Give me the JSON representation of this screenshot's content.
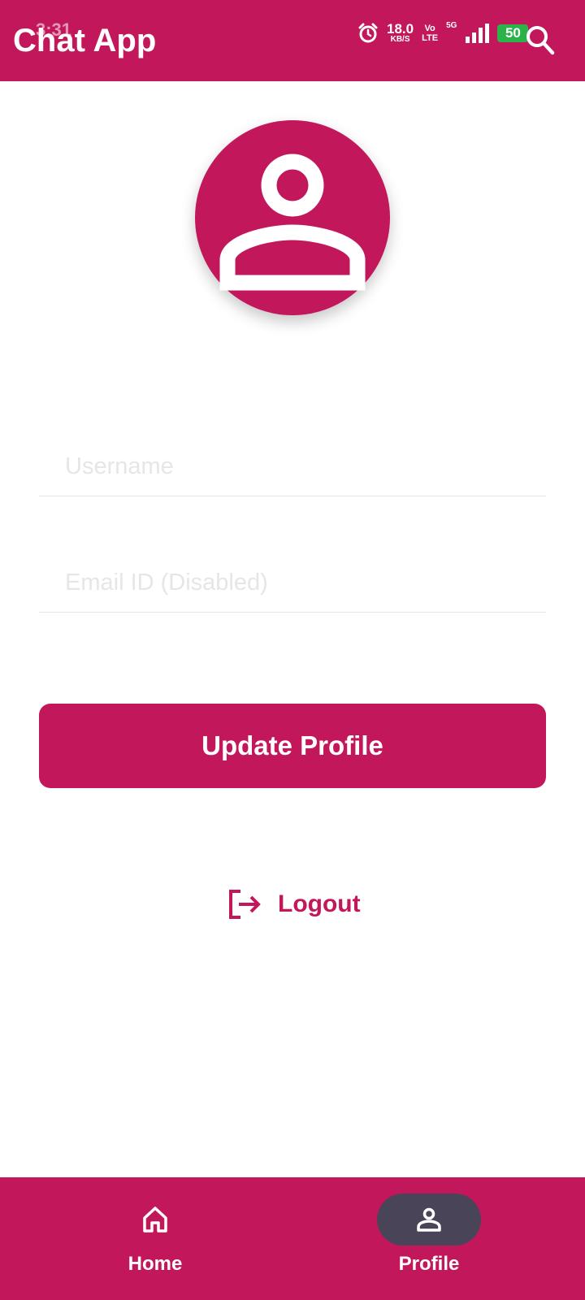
{
  "status_bar": {
    "time": "3:31",
    "net_speed_value": "18.0",
    "net_speed_unit": "KB/S",
    "volte_top": "Vo",
    "volte_bottom": "LTE",
    "network_type": "5G",
    "battery_level": "50"
  },
  "app_bar": {
    "title": "Chat App",
    "action_icon": "search-icon"
  },
  "profile": {
    "avatar_icon": "person-icon",
    "username": {
      "value": "",
      "placeholder": "Username"
    },
    "email": {
      "value": "",
      "placeholder": "Email ID (Disabled)"
    },
    "update_button_label": "Update Profile",
    "logout_label": "Logout",
    "logout_icon": "logout-icon"
  },
  "bottom_nav": {
    "items": [
      {
        "label": "Home",
        "icon": "home-icon",
        "active": false
      },
      {
        "label": "Profile",
        "icon": "person-icon",
        "active": true
      }
    ]
  },
  "colors": {
    "primary": "#c2185b",
    "active_pill": "#4a4458",
    "battery": "#2bb34a"
  }
}
